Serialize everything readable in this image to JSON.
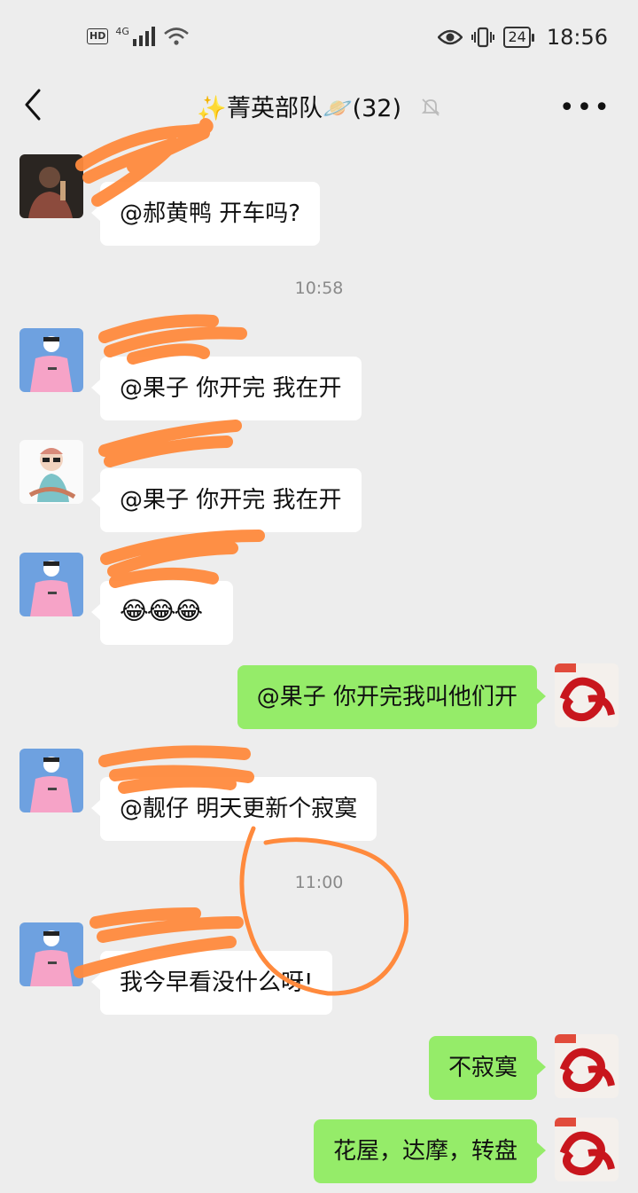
{
  "status_bar": {
    "network_badge": "HD",
    "network_type": "4G",
    "signal_icon": "signal-bars-icon",
    "wifi_icon": "wifi-icon",
    "battery": "24",
    "time": "18:56"
  },
  "header": {
    "title": "✨菁英部队🪐(32)",
    "back_icon": "chevron-left-icon",
    "mute_icon": "bell-muted-icon",
    "more_icon": "more-dots-icon"
  },
  "messages": [
    {
      "side": "left",
      "text": "@郝黄鸭  开车吗?"
    },
    {
      "type": "time",
      "text": "10:58"
    },
    {
      "side": "left",
      "text": "@果子  你开完 我在开"
    },
    {
      "side": "left",
      "text": "@果子  你开完 我在开"
    },
    {
      "side": "left",
      "text": "😂😂😂"
    },
    {
      "side": "right",
      "text": "@果子  你开完我叫他们开"
    },
    {
      "side": "left",
      "text": "@靓仔  明天更新个寂寞"
    },
    {
      "type": "time",
      "text": "11:00"
    },
    {
      "side": "left",
      "text": "我今早看没什么呀!"
    },
    {
      "side": "right",
      "text": "不寂寞"
    },
    {
      "side": "right",
      "text": "花屋，达摩，转盘"
    }
  ],
  "colors": {
    "background": "#ededed",
    "bubble_self": "#95ec69",
    "bubble_other": "#ffffff",
    "scribble": "#ff8a3d"
  }
}
